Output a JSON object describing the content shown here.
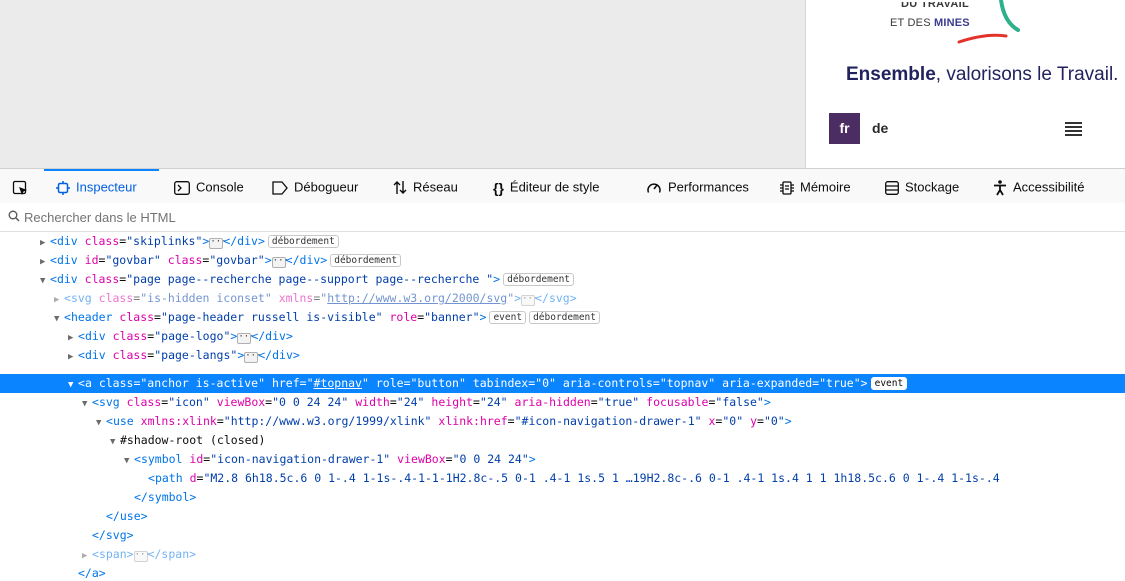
{
  "preview": {
    "logo_line1": "DU TRAVAIL",
    "logo_line2_prefix": "ET DES ",
    "logo_line2_bold": "MINES",
    "tagline_bold": "Ensemble",
    "tagline_rest": ", valorisons le Travail.",
    "lang_fr": "fr",
    "lang_de": "de"
  },
  "toolbar": {
    "inspector": "Inspecteur",
    "console": "Console",
    "debugger": "Débogueur",
    "network": "Réseau",
    "style_editor": "Éditeur de style",
    "performance": "Performances",
    "memory": "Mémoire",
    "storage": "Stockage",
    "accessibility": "Accessibilité"
  },
  "search": {
    "placeholder": "Rechercher dans le HTML"
  },
  "badges": {
    "overflow": "débordement",
    "event": "event",
    "ellipsis": "···"
  },
  "tree": {
    "r1": {
      "open": "<",
      "tag": "div",
      "attr1": "class",
      "val1": "\"skiplinks\"",
      "mid": ">",
      "close": "</div>"
    },
    "r2": {
      "tag": "div",
      "attr1": "id",
      "val1": "\"govbar\"",
      "attr2": "class",
      "val2": "\"govbar\"",
      "close": "</div>"
    },
    "r3": {
      "tag": "div",
      "attr1": "class",
      "val1": "\"page page--recherche page--support page--recherche \""
    },
    "r4": {
      "tag": "svg",
      "attr1": "class",
      "val1": "\"is-hidden iconset\"",
      "attr2": "xmlns",
      "val2_q1": "\"",
      "val2_link": "http://www.w3.org/2000/svg",
      "val2_q2": "\"",
      "close": "</svg>"
    },
    "r5": {
      "tag": "header",
      "attr1": "class",
      "val1": "\"page-header russell is-visible\"",
      "attr2": "role",
      "val2": "\"banner\""
    },
    "r6": {
      "tag": "div",
      "attr1": "class",
      "val1": "\"page-logo\"",
      "close": "</div>"
    },
    "r7": {
      "tag": "div",
      "attr1": "class",
      "val1": "\"page-langs\"",
      "close": "</div>"
    },
    "r8": {
      "tag": "a",
      "attr1": "class",
      "val1": "\"anchor is-active\"",
      "attr2": "href",
      "val2_q1": "\"",
      "val2_link": "#topnav",
      "val2_q2": "\"",
      "attr3": "role",
      "val3": "\"button\"",
      "attr4": "tabindex",
      "val4": "\"0\"",
      "attr5": "aria-controls",
      "val5": "\"topnav\"",
      "attr6": "aria-expanded",
      "val6": "\"true\""
    },
    "r9": {
      "tag": "svg",
      "attr1": "class",
      "val1": "\"icon\"",
      "attr2": "viewBox",
      "val2": "\"0 0 24 24\"",
      "attr3": "width",
      "val3": "\"24\"",
      "attr4": "height",
      "val4": "\"24\"",
      "attr5": "aria-hidden",
      "val5": "\"true\"",
      "attr6": "focusable",
      "val6": "\"false\""
    },
    "r10": {
      "tag": "use",
      "attr1": "xmlns:xlink",
      "val1": "\"http://www.w3.org/1999/xlink\"",
      "attr2": "xlink:href",
      "val2": "\"#icon-navigation-drawer-1\"",
      "attr3": "x",
      "val3": "\"0\"",
      "attr4": "y",
      "val4": "\"0\""
    },
    "r11": {
      "text": "#shadow-root (closed)"
    },
    "r12": {
      "tag": "symbol",
      "attr1": "id",
      "val1": "\"icon-navigation-drawer-1\"",
      "attr2": "viewBox",
      "val2": "\"0 0 24 24\""
    },
    "r13": {
      "tag": "path",
      "attr1": "d",
      "val1": "\"M2.8 6h18.5c.6 0 1-.4 1-1s-.4-1-1-1H2.8c-.5 0-1 .4-1 1s.5 1 …19H2.8c-.6 0-1 .4-1 1s.4 1 1 1h18.5c.6 0 1-.4 1-1s-.4"
    },
    "r14": {
      "close": "</symbol>"
    },
    "r15": {
      "close": "</use>"
    },
    "r16": {
      "close": "</svg>"
    },
    "r17": {
      "tag": "span",
      "close": "</span>"
    },
    "r18": {
      "close": "</a>"
    }
  }
}
